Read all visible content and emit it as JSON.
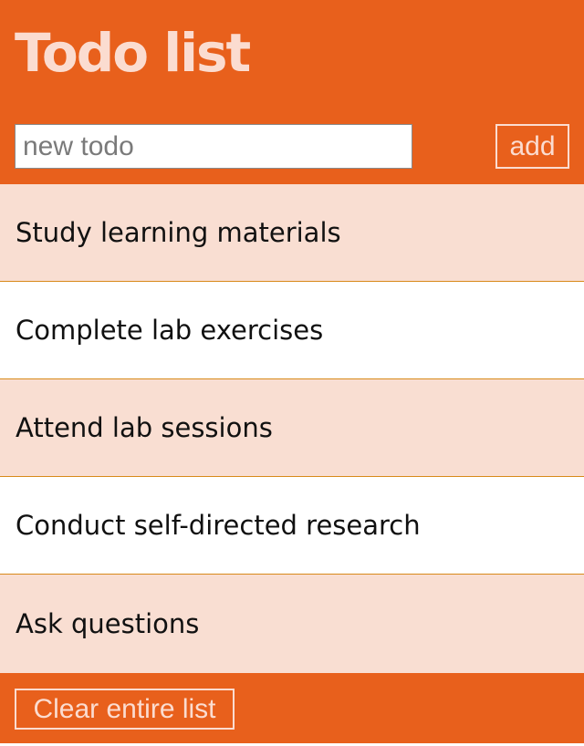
{
  "header": {
    "title": "Todo list",
    "input_placeholder": "new todo",
    "input_value": "",
    "add_label": "add"
  },
  "todos": [
    {
      "label": "Study learning materials"
    },
    {
      "label": "Complete lab exercises"
    },
    {
      "label": "Attend lab sessions"
    },
    {
      "label": "Conduct self-directed research"
    },
    {
      "label": "Ask questions"
    }
  ],
  "footer": {
    "clear_label": "Clear entire list"
  },
  "colors": {
    "accent": "#e8601c",
    "accent_text": "#fbdcd0",
    "row_odd": "#f9ded2",
    "row_even": "#ffffff",
    "divider": "#d88a1a"
  }
}
